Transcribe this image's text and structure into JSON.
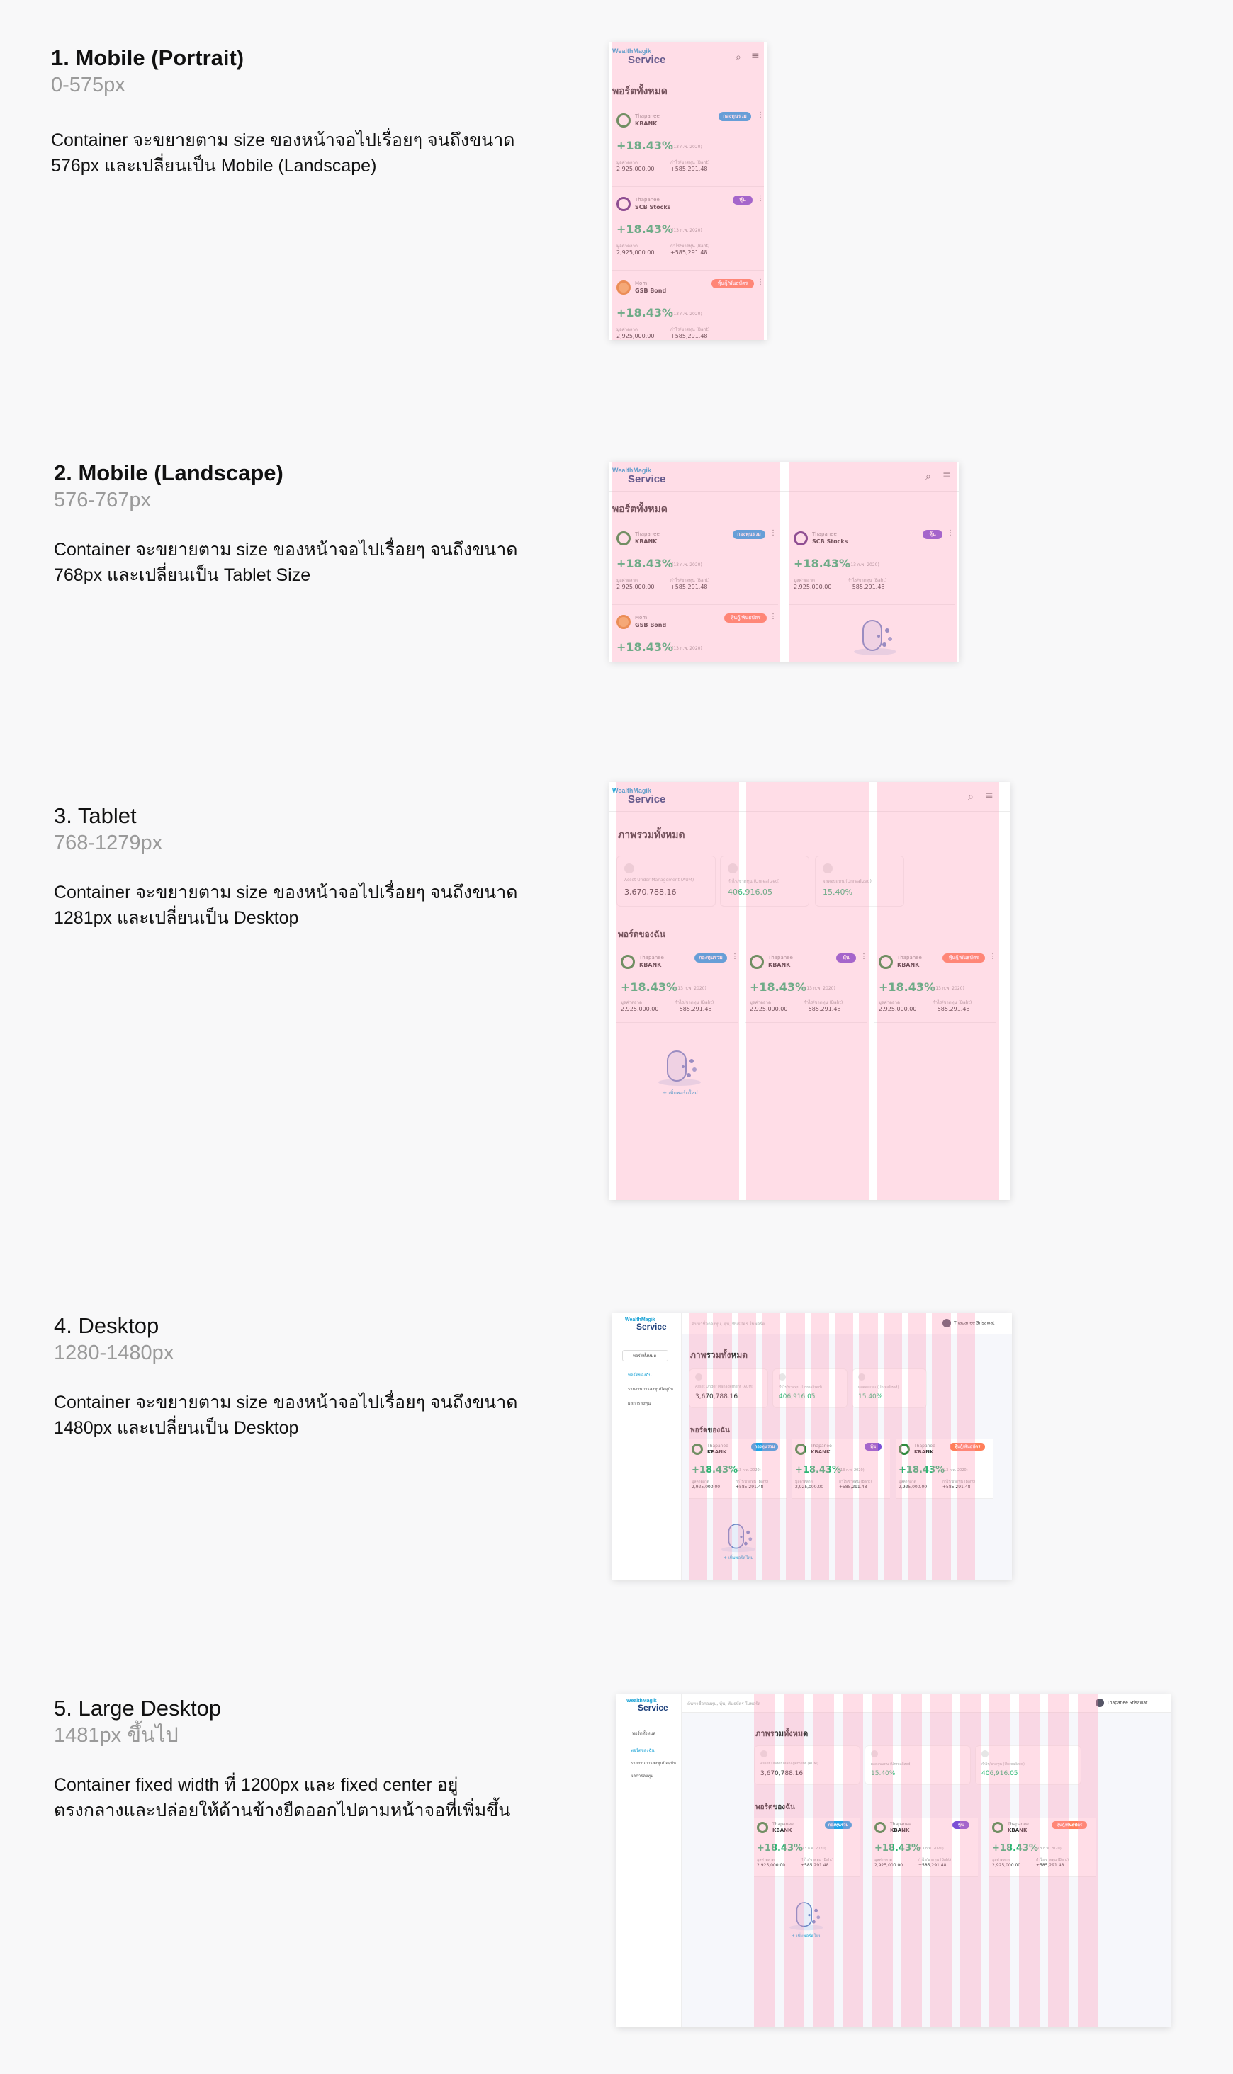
{
  "sections": [
    {
      "title": "1. Mobile (Portrait)",
      "range": "0-575px",
      "desc": "Container จะขยายตาม size ของหน้าจอไปเรื่อยๆ จนถึงขนาด\n576px และเปลี่ยนเป็น Mobile (Landscape)"
    },
    {
      "title": "2. Mobile (Landscape)",
      "range": "576-767px",
      "desc": "Container จะขยายตาม size ของหน้าจอไปเรื่อยๆ จนถึงขนาด\n768px และเปลี่ยนเป็น Tablet Size"
    },
    {
      "title": "3. Tablet",
      "range": "768-1279px",
      "desc": "Container จะขยายตาม size ของหน้าจอไปเรื่อยๆ จนถึงขนาด\n1281px และเปลี่ยนเป็น Desktop"
    },
    {
      "title": "4. Desktop",
      "range": "1280-1480px",
      "desc": "Container จะขยายตาม size ของหน้าจอไปเรื่อยๆ จนถึงขนาด\n1480px และเปลี่ยนเป็น Desktop"
    },
    {
      "title": "5. Large Desktop",
      "range": "1481px ขึ้นไป",
      "desc": "Container fixed width ที่ 1200px และ fixed center อยู่\nตรงกลางและปล่อยให้ด้านข้างยืดออกไปตามหน้าจอที่เพิ่มขึ้น"
    }
  ],
  "app": {
    "logo_top": "WealthMagik",
    "logo_bottom": "Service",
    "all_ports": "พอร์ตทั้งหมด",
    "overview": "ภาพรวมทั้งหมด",
    "my_ports": "พอร์ตของฉัน",
    "add_port": "+ เพิ่มพอร์ตใหม่",
    "search_placeholder": "ค้นหาชื่อกองทุน, หุ้น, พันธบัตร ในพอร์ต",
    "user_name": "Thapanee Srisawat",
    "sidebar": {
      "dropdown": "พอร์ตทั้งหมด",
      "items": [
        "พอร์ตของฉัน",
        "รายงานการลงทุนปัจจุบัน",
        "ผลการลงทุน"
      ]
    },
    "stats": [
      {
        "label": "Asset Under Management (AUM)",
        "value": "3,670,788.16"
      },
      {
        "label": "กำไร/ขาดทุน (Unrealized)",
        "value": "406,916.05"
      },
      {
        "label": "ผลตอบแทน (Unrealized)",
        "value": "15.40%"
      }
    ],
    "cards": [
      {
        "owner": "Thapanee",
        "name": "KBANK",
        "badge": "กองทุนรวม",
        "badge_color": "#1fa3e8",
        "pct": "+18.43%",
        "date": "(13 ก.พ. 2020)",
        "label_cost": "มูลค่าตลาด",
        "cost": "2,925,000.00",
        "label_pl": "กำไร/ขาดทุน (Baht)",
        "pl": "+585,291.48"
      },
      {
        "owner": "Thapanee",
        "name": "SCB Stocks",
        "badge": "หุ้น",
        "badge_color": "#7b4fd6",
        "pct": "+18.43%",
        "date": "(13 ก.พ. 2020)",
        "label_cost": "มูลค่าตลาด",
        "cost": "2,925,000.00",
        "label_pl": "กำไร/ขาดทุน (Baht)",
        "pl": "+585,291.48"
      },
      {
        "owner": "Mom",
        "name": "GSB Bond",
        "badge": "หุ้นกู้/พันธบัตร",
        "badge_color": "#ff7f5a",
        "pct": "+18.43%",
        "date": "(13 ก.พ. 2020)",
        "label_cost": "มูลค่าตลาด",
        "cost": "2,925,000.00",
        "label_pl": "กำไร/ขาดทุน (Baht)",
        "pl": "+585,291.48"
      }
    ],
    "kbank_cards": [
      {
        "owner": "Thapanee",
        "name": "KBANK",
        "badge": "กองทุนรวม"
      },
      {
        "owner": "Thapanee",
        "name": "KBANK",
        "badge": "หุ้น"
      },
      {
        "owner": "Thapanee",
        "name": "KBANK",
        "badge": "หุ้นกู้/พันธบัตร"
      }
    ]
  }
}
